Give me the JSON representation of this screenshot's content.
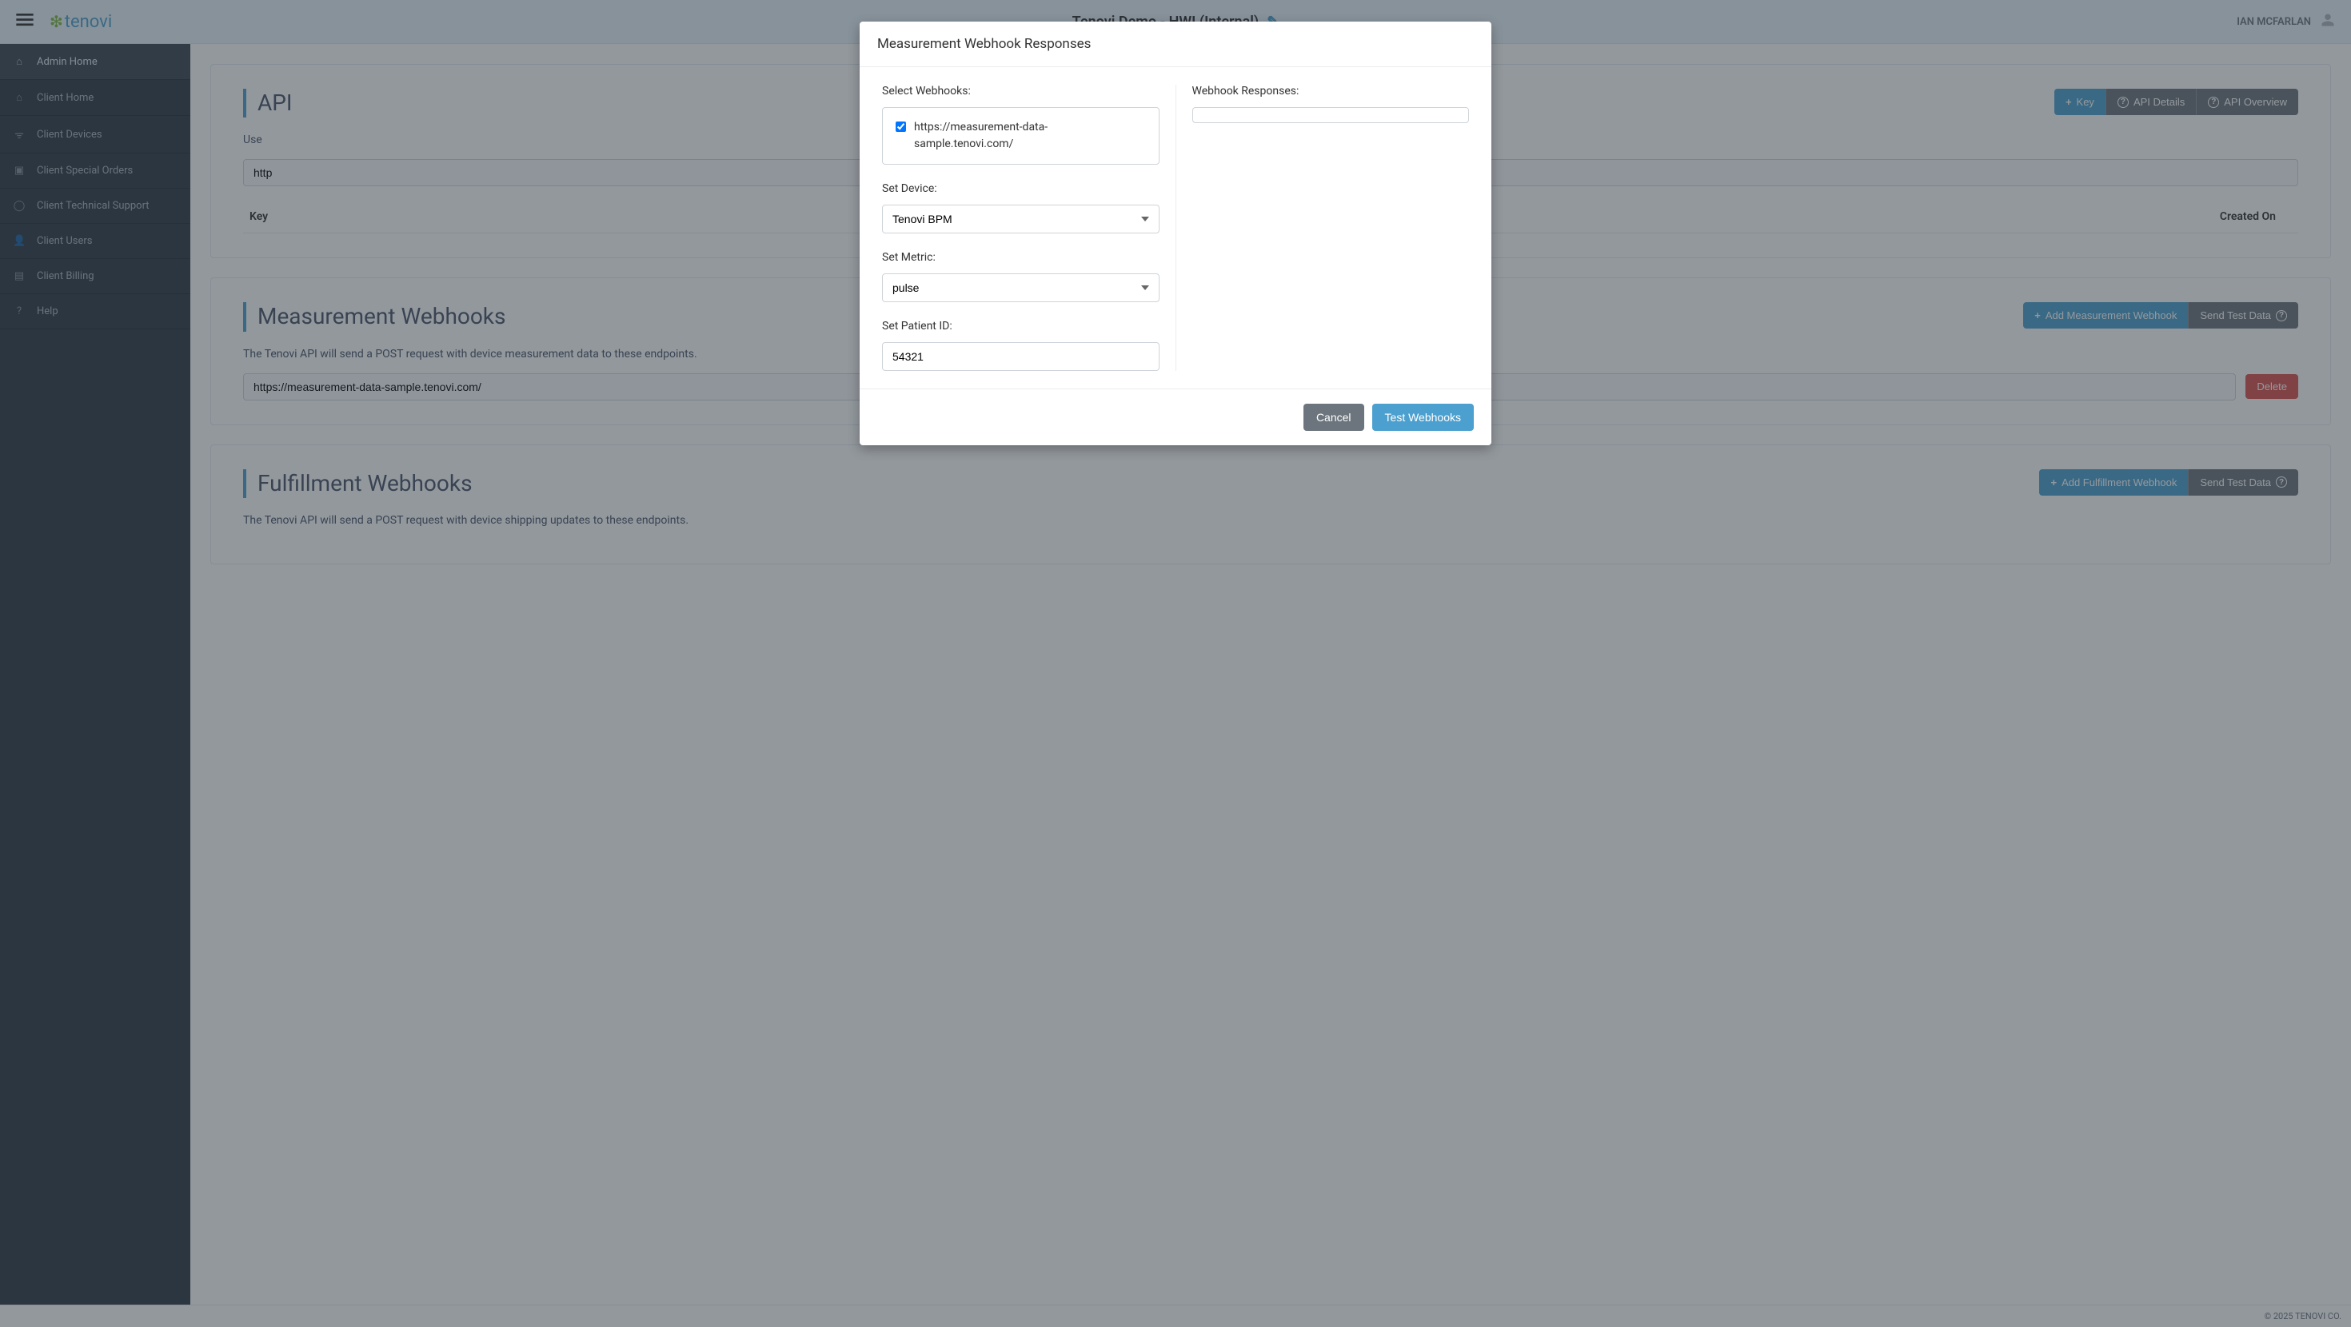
{
  "header": {
    "brand": "tenovi",
    "title": "Tenovi Demo - HWI (Internal)",
    "user_name": "IAN MCFARLAN"
  },
  "sidebar": {
    "items": [
      {
        "label": "Admin Home"
      },
      {
        "label": "Client Home"
      },
      {
        "label": "Client Devices"
      },
      {
        "label": "Client Special Orders"
      },
      {
        "label": "Client Technical Support"
      },
      {
        "label": "Client Users"
      },
      {
        "label": "Client Billing"
      },
      {
        "label": "Help"
      }
    ]
  },
  "cards": {
    "api": {
      "title": "API",
      "btn_key_label": "Key",
      "btn_details_label": "API Details",
      "btn_overview_label": "API Overview",
      "use_label": "Use",
      "url_value": "http",
      "table_col1": "Key",
      "table_col2": "Created On"
    },
    "measurement": {
      "title": "Measurement Webhooks",
      "btn_add_label": "Add Measurement Webhook",
      "btn_send_label": "Send Test Data",
      "desc": "The Tenovi API will send a POST request with device measurement data to these endpoints.",
      "url_value": "https://measurement-data-sample.tenovi.com/",
      "btn_delete": "Delete"
    },
    "fulfillment": {
      "title": "Fulfillment Webhooks",
      "btn_add_label": "Add Fulfillment Webhook",
      "btn_send_label": "Send Test Data",
      "desc": "The Tenovi API will send a POST request with device shipping updates to these endpoints."
    }
  },
  "modal": {
    "title": "Measurement Webhook Responses",
    "select_webhooks_label": "Select Webhooks:",
    "webhook_url": "https://measurement-data-sample.tenovi.com/",
    "set_device_label": "Set Device:",
    "device_value": "Tenovi BPM",
    "set_metric_label": "Set Metric:",
    "metric_value": "pulse",
    "set_patient_label": "Set Patient ID:",
    "patient_value": "54321",
    "responses_label": "Webhook Responses:",
    "cancel_label": "Cancel",
    "test_label": "Test Webhooks"
  },
  "footer": {
    "text": "© 2025 TENOVI CO."
  }
}
